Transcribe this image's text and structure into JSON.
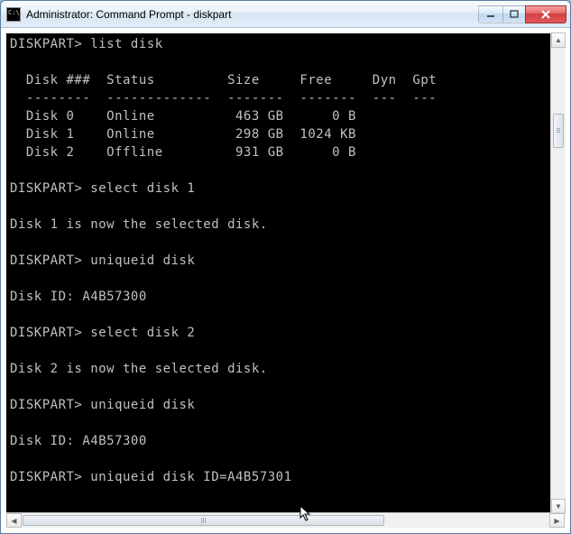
{
  "window": {
    "title": "Administrator: Command Prompt - diskpart"
  },
  "terminal": {
    "prompt": "DISKPART>",
    "commands": {
      "list_disk": "list disk",
      "select_disk_1": "select disk 1",
      "uniqueid_disk_1": "uniqueid disk",
      "select_disk_2": "select disk 2",
      "uniqueid_disk_2": "uniqueid disk",
      "set_uniqueid": "uniqueid disk ID=A4B57301"
    },
    "headers": {
      "disk_num": "Disk ###",
      "status": "Status",
      "size": "Size",
      "free": "Free",
      "dyn": "Dyn",
      "gpt": "Gpt"
    },
    "disks": [
      {
        "num": "Disk 0",
        "status": "Online",
        "size": "463 GB",
        "free": "0 B"
      },
      {
        "num": "Disk 1",
        "status": "Online",
        "size": "298 GB",
        "free": "1024 KB"
      },
      {
        "num": "Disk 2",
        "status": "Offline",
        "size": "931 GB",
        "free": "0 B"
      }
    ],
    "messages": {
      "disk1_selected": "Disk 1 is now the selected disk.",
      "disk2_selected": "Disk 2 is now the selected disk.",
      "disk_id_1": "Disk ID: A4B57300",
      "disk_id_2": "Disk ID: A4B57300"
    }
  },
  "lines": {
    "l1": "DISKPART> list disk",
    "l2": "  Disk ###  Status         Size     Free     Dyn  Gpt",
    "l3": "  --------  -------------  -------  -------  ---  ---",
    "l4": "  Disk 0    Online          463 GB      0 B",
    "l5": "  Disk 1    Online          298 GB  1024 KB",
    "l6": "  Disk 2    Offline         931 GB      0 B",
    "l7": "DISKPART> select disk 1",
    "l8": "Disk 1 is now the selected disk.",
    "l9": "DISKPART> uniqueid disk",
    "l10": "Disk ID: A4B57300",
    "l11": "DISKPART> select disk 2",
    "l12": "Disk 2 is now the selected disk.",
    "l13": "DISKPART> uniqueid disk",
    "l14": "Disk ID: A4B57300",
    "l15": "DISKPART> uniqueid disk ID=A4B57301"
  }
}
